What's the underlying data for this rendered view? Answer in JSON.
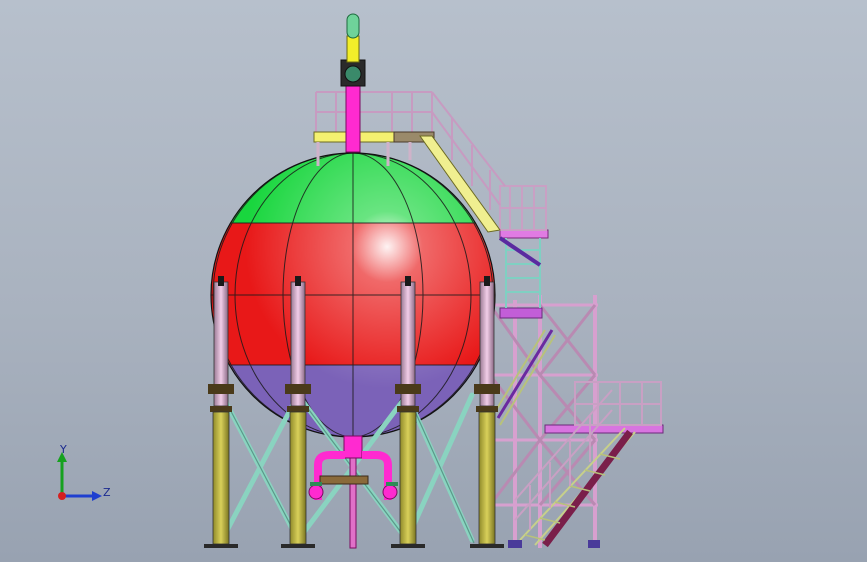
{
  "scene": {
    "colors": {
      "background_top": "#b7c0cc",
      "background_bottom": "#98a2b1",
      "sphere_top": "#00c83a",
      "sphere_middle": "#e61919",
      "sphere_bottom": "#7a5fb0",
      "column": "#c8bd3f",
      "column_top": "#d7a7c9",
      "brace": "#9ad6c8",
      "platform_deck": "#f0ef7a",
      "railing": "#e8a0d8",
      "stair_tower": "#e8a0d8",
      "pipe": "#ff2ad0",
      "valve": "#2e8b57"
    }
  },
  "triad": {
    "y_label": "Y",
    "z_label": "Z"
  }
}
